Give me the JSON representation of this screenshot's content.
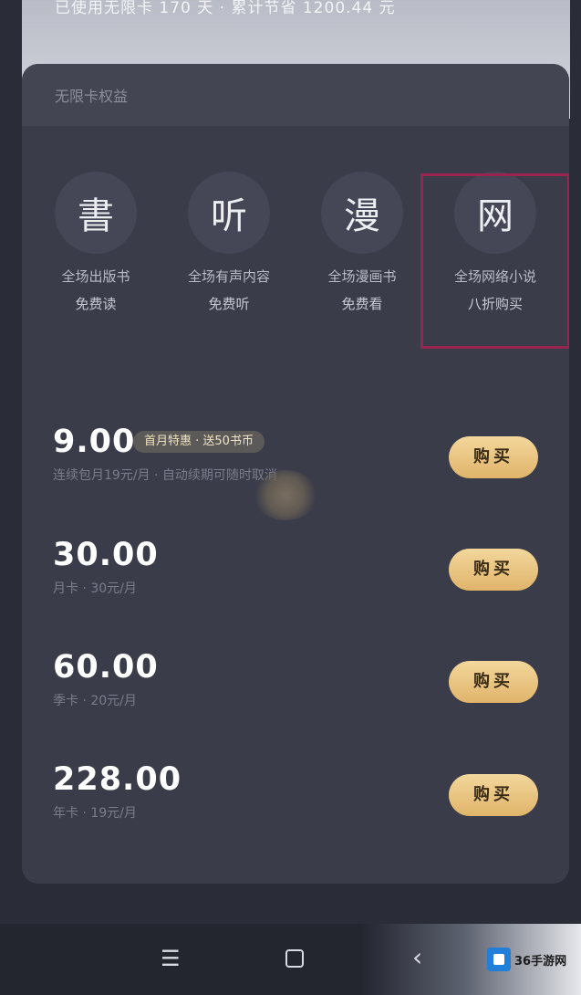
{
  "top_banner": {
    "text": "已使用无限卡 170 天 · 累计节省 1200.44 元"
  },
  "card": {
    "title": "无限卡权益"
  },
  "benefits": [
    {
      "glyph": "書",
      "line1": "全场出版书",
      "line2": "免费读"
    },
    {
      "glyph": "听",
      "line1": "全场有声内容",
      "line2": "免费听"
    },
    {
      "glyph": "漫",
      "line1": "全场漫画书",
      "line2": "免费看"
    },
    {
      "glyph": "网",
      "line1": "全场网络小说",
      "line2": "八折购买"
    }
  ],
  "plans": [
    {
      "price": "9.00",
      "tag": "首月特惠 · 送50书币",
      "desc": "连续包月19元/月 · 自动续期可随时取消",
      "buy_label": "购买"
    },
    {
      "price": "30.00",
      "tag": "",
      "desc": "月卡 · 30元/月",
      "buy_label": "购买"
    },
    {
      "price": "60.00",
      "tag": "",
      "desc": "季卡 · 20元/月",
      "buy_label": "购买"
    },
    {
      "price": "228.00",
      "tag": "",
      "desc": "年卡 · 19元/月",
      "buy_label": "购买"
    }
  ],
  "navbar": {
    "menu_icon": "menu-icon",
    "home_icon": "home-icon",
    "back_icon": "back-icon"
  },
  "watermark": {
    "text": "36手游网"
  },
  "colors": {
    "accent_gold": "#e8c27f",
    "highlight_border": "#9a2350",
    "card_bg": "#3a3c49"
  }
}
